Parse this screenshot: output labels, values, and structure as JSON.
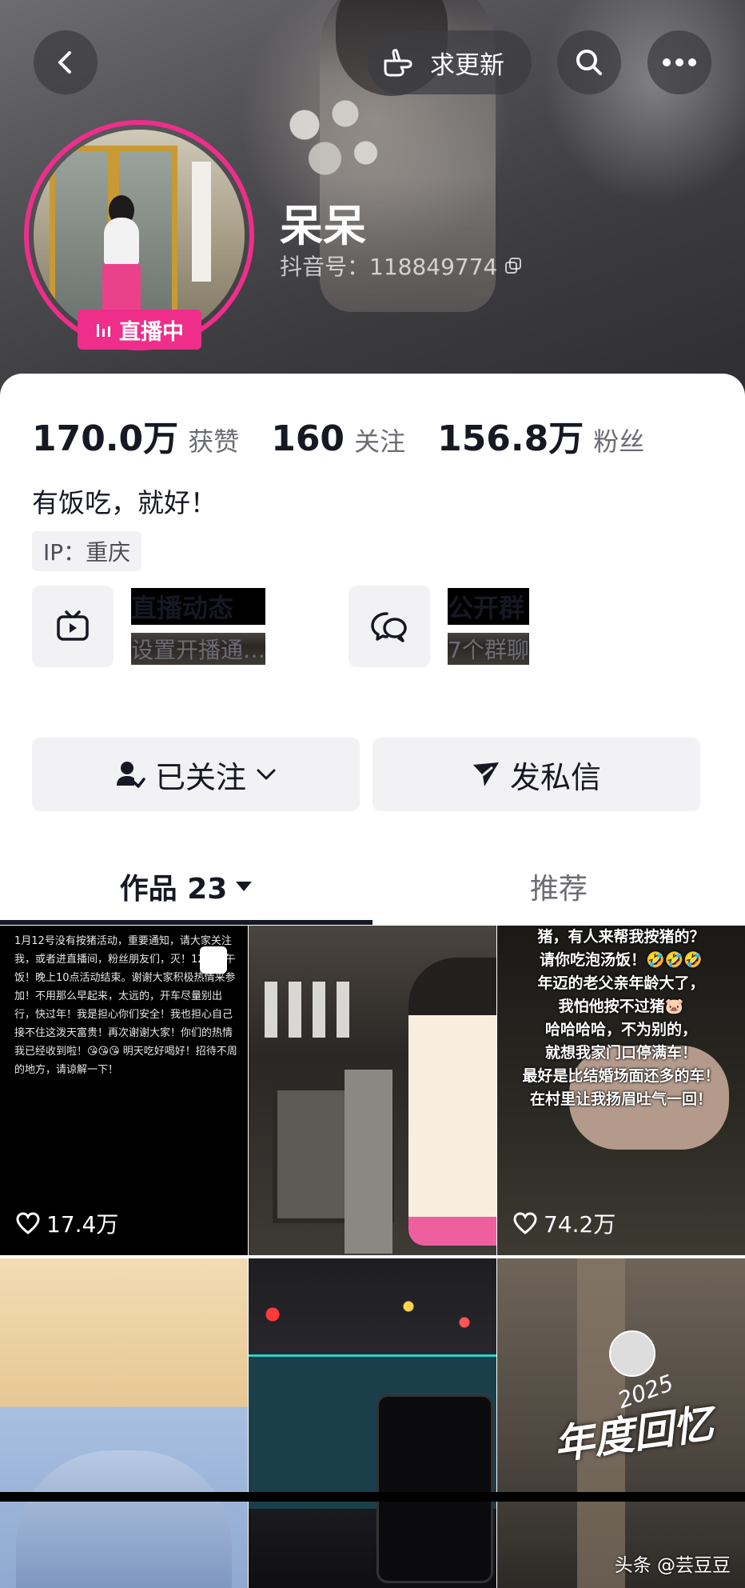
{
  "header": {
    "request_update_label": "求更新"
  },
  "profile": {
    "name": "呆呆",
    "douyin_id": "抖音号：118849774",
    "live_badge": "直播中",
    "stats": [
      {
        "value": "170.0万",
        "label": "获赞"
      },
      {
        "value": "160",
        "label": "关注"
      },
      {
        "value": "156.8万",
        "label": "粉丝"
      }
    ],
    "bio": "有饭吃，就好！",
    "ip": "IP：重庆"
  },
  "features": {
    "live": {
      "title": "直播动态",
      "subtitle": "设置开播通…"
    },
    "group": {
      "title": "公开群",
      "subtitle": "7个群聊"
    }
  },
  "actions": {
    "follow_label": "已关注",
    "message_label": "发私信"
  },
  "tabs": {
    "works": "作品 23",
    "recommend": "推荐"
  },
  "posts": [
    {
      "likes": "17.4万",
      "caption": "1月12号没有按猪活动，重要通知，请大家关注我，或者进直播间，粉丝朋友们，灭！12点吃午饭！晚上10点活动结束。谢谢大家积极热情来参加！不用那么早起来，太远的，开车尽量别出行，快过年！我是担心你们安全！我也担心自己接不住这泼天富贵！再次谢谢大家！你们的热情我已经收到啦！😘😘😘 明天吃好喝好！招待不周的地方，请谅解一下！"
    },
    {
      "likes": ""
    },
    {
      "likes": "74.2万",
      "overlay_lines": [
        "猪，有人来帮我按猪的？",
        "请你吃泡汤饭！🤣🤣🤣",
        "年迈的老父亲年龄大了，",
        "我怕他按不过猪🐷",
        "哈哈哈哈，不为别的，",
        "就想我家门口停满车！",
        "最好是比结婚场面还多的车！",
        "在村里让我扬眉吐气一回！"
      ]
    },
    {
      "likes": ""
    },
    {
      "likes": ""
    },
    {
      "likes": "",
      "overlay_title": "年度回忆",
      "overlay_year": "2025"
    }
  ],
  "watermark": "头条 @芸豆豆"
}
